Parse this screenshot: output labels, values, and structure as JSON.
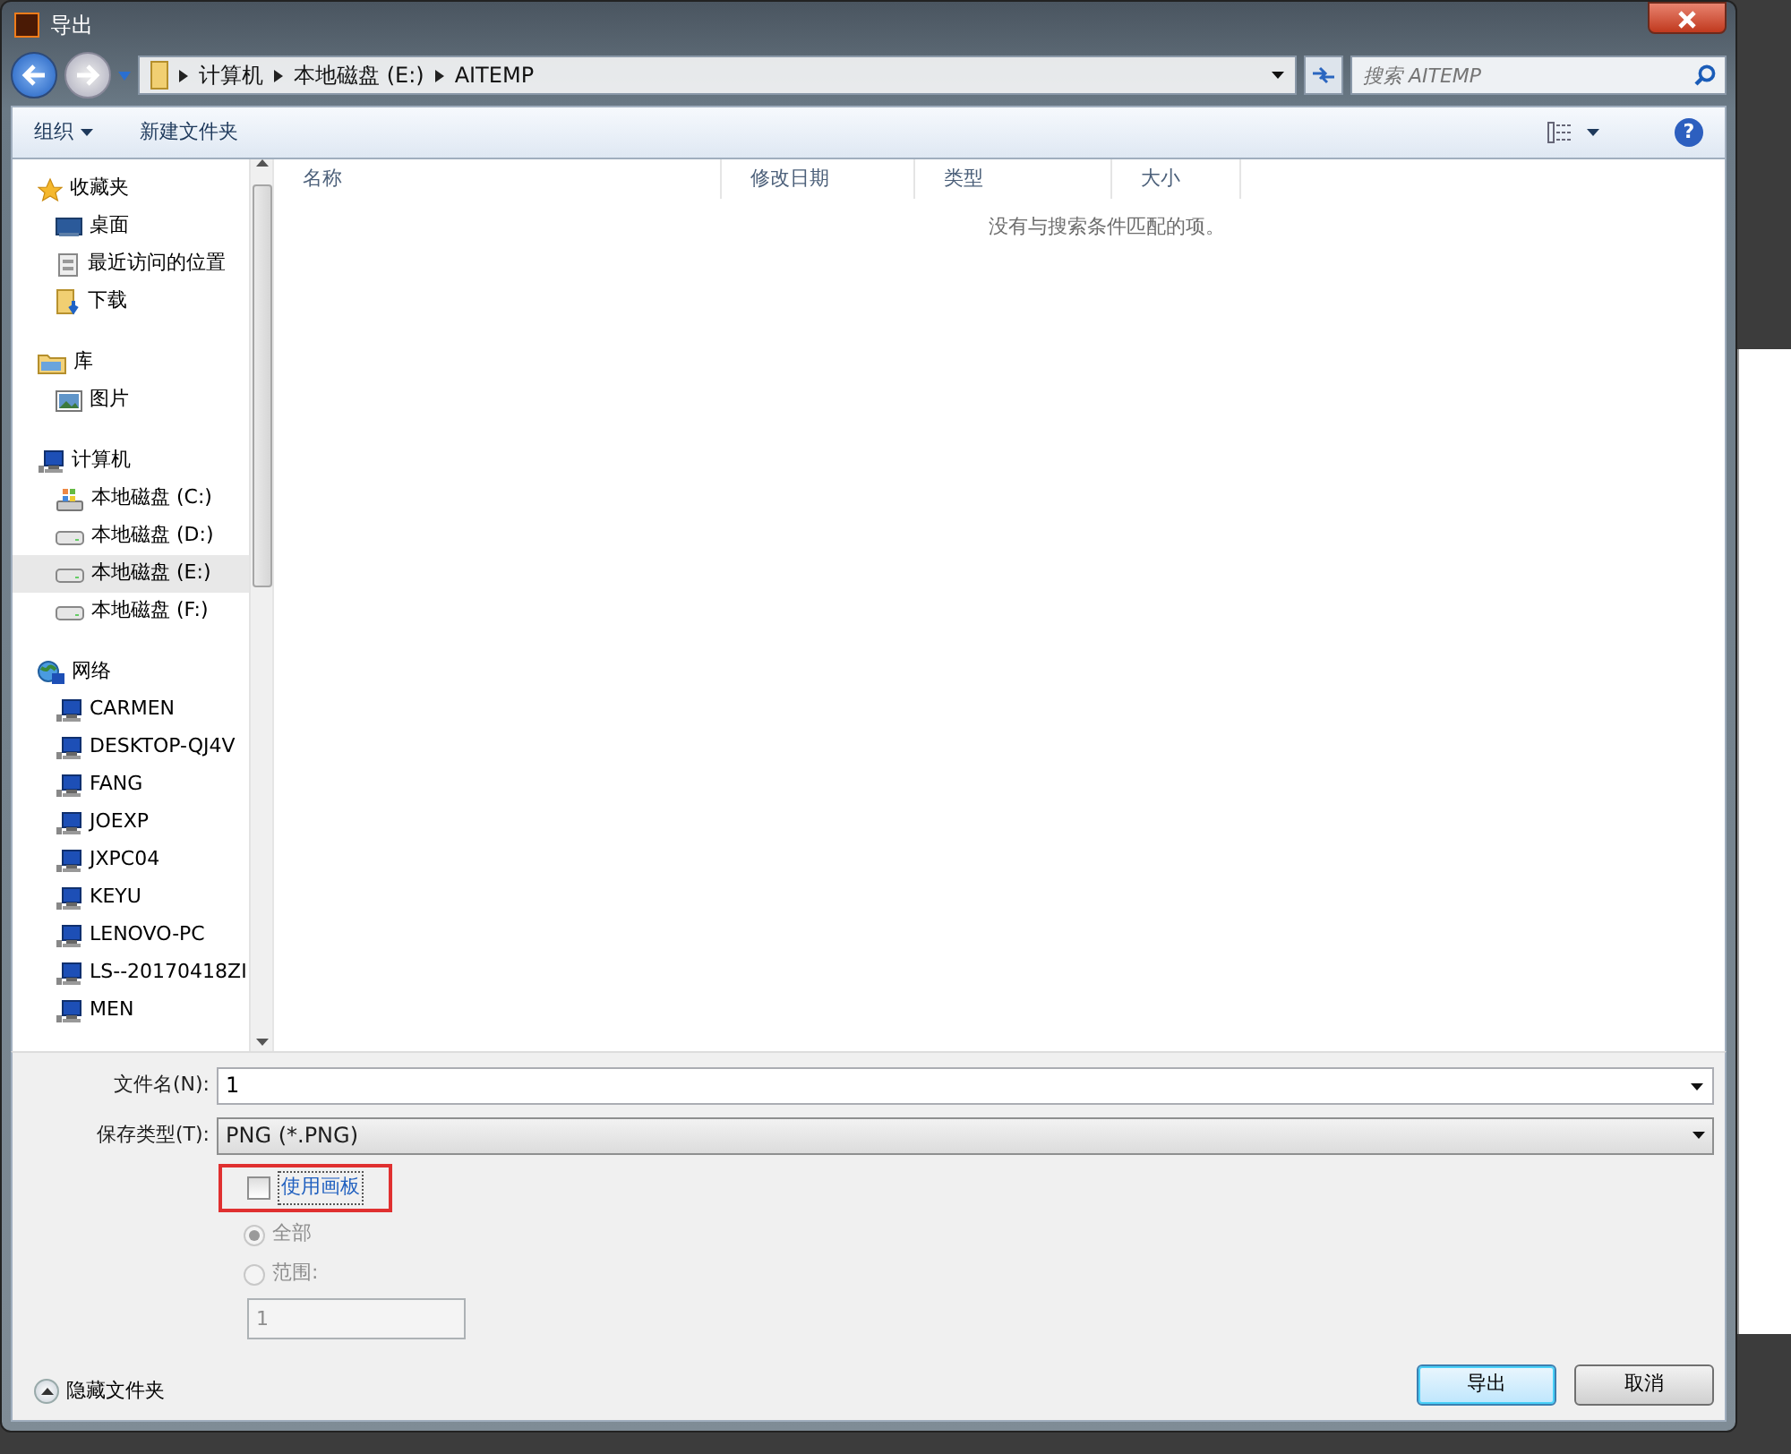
{
  "window": {
    "title": "导出"
  },
  "address_bar": {
    "crumbs": [
      "计算机",
      "本地磁盘 (E:)",
      "AITEMP"
    ]
  },
  "search": {
    "placeholder": "搜索 AITEMP"
  },
  "toolbar": {
    "organize": "组织",
    "new_folder": "新建文件夹",
    "help": "?"
  },
  "sidebar": {
    "groups": [
      {
        "label": "收藏夹",
        "kind": "star",
        "children": [
          {
            "label": "桌面",
            "kind": "desktop",
            "selected": false
          },
          {
            "label": "最近访问的位置",
            "kind": "recent",
            "selected": false
          },
          {
            "label": "下载",
            "kind": "download",
            "selected": false
          }
        ]
      },
      {
        "label": "库",
        "kind": "library",
        "children": [
          {
            "label": "图片",
            "kind": "picture",
            "selected": false
          }
        ]
      },
      {
        "label": "计算机",
        "kind": "computer",
        "children": [
          {
            "label": "本地磁盘 (C:)",
            "kind": "sysdrive",
            "selected": false
          },
          {
            "label": "本地磁盘 (D:)",
            "kind": "drive",
            "selected": false
          },
          {
            "label": "本地磁盘 (E:)",
            "kind": "drive",
            "selected": true
          },
          {
            "label": "本地磁盘 (F:)",
            "kind": "drive",
            "selected": false
          }
        ]
      },
      {
        "label": "网络",
        "kind": "network",
        "children": [
          {
            "label": "CARMEN",
            "kind": "computer",
            "selected": false
          },
          {
            "label": "DESKTOP-QJ4V",
            "kind": "computer",
            "selected": false
          },
          {
            "label": "FANG",
            "kind": "computer",
            "selected": false
          },
          {
            "label": "JOEXP",
            "kind": "computer",
            "selected": false
          },
          {
            "label": "JXPC04",
            "kind": "computer",
            "selected": false
          },
          {
            "label": "KEYU",
            "kind": "computer",
            "selected": false
          },
          {
            "label": "LENOVO-PC",
            "kind": "computer",
            "selected": false
          },
          {
            "label": "LS--20170418ZI",
            "kind": "computer",
            "selected": false
          },
          {
            "label": "MEN",
            "kind": "computer",
            "selected": false
          }
        ]
      }
    ]
  },
  "file_list": {
    "columns": [
      "名称",
      "修改日期",
      "类型",
      "大小"
    ],
    "empty_message": "没有与搜索条件匹配的项。"
  },
  "form": {
    "file_name_label": "文件名(N):",
    "file_name": "1",
    "type_label": "保存类型(T):",
    "type_value": "PNG (*.PNG)"
  },
  "options": {
    "artboard": {
      "label": "使用画板",
      "checked": false,
      "highlighted": true
    },
    "radios": [
      {
        "label": "全部",
        "selected": true,
        "disabled": true
      },
      {
        "label": "范围:",
        "selected": false,
        "disabled": true
      }
    ],
    "range": {
      "value": "1",
      "disabled": true
    }
  },
  "hide_folders": "隐藏文件夹",
  "buttons": [
    {
      "label": "导出",
      "default": true
    },
    {
      "label": "取消",
      "default": false
    }
  ]
}
